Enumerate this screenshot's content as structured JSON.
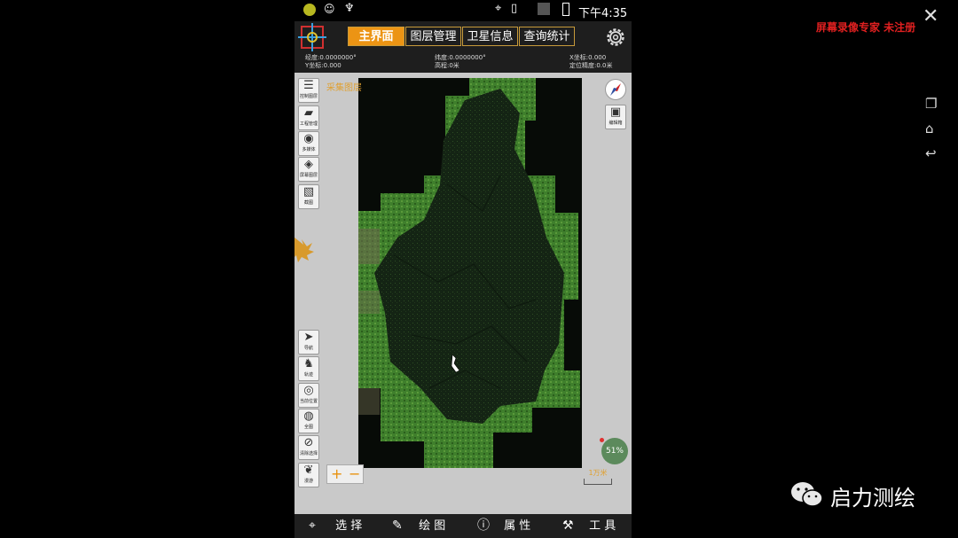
{
  "status_bar": {
    "time": "下午4:35"
  },
  "toolbar": {
    "tabs": [
      {
        "label": "主界面",
        "active": true
      },
      {
        "label": "图层管理",
        "active": false
      },
      {
        "label": "卫星信息",
        "active": false
      },
      {
        "label": "查询统计",
        "active": false
      }
    ]
  },
  "coords": {
    "lon": "经度:0.0000000°",
    "y": "Y坐标:0.000",
    "lat": "纬度:0.0000000°",
    "elev": "高程:0米",
    "x": "X坐标:0.000",
    "acc": "定位精度:0.0米"
  },
  "map": {
    "layer_label": "采集图层",
    "battery": "51%",
    "scale": "1万米"
  },
  "left_tools": [
    {
      "icon": "list-icon",
      "label": "控制图层"
    },
    {
      "icon": "folder-icon",
      "label": "工程管理"
    },
    {
      "icon": "camera-icon",
      "label": "多媒体"
    },
    {
      "icon": "layers-icon",
      "label": "屏幕图层"
    },
    {
      "icon": "image-icon",
      "label": "截图"
    }
  ],
  "left_tools_lower": [
    {
      "icon": "navigate-icon",
      "label": "导航"
    },
    {
      "icon": "track-icon",
      "label": "轨迹"
    },
    {
      "icon": "locate-icon",
      "label": "当前位置"
    },
    {
      "icon": "globe-icon",
      "label": "全图"
    },
    {
      "icon": "clear-icon",
      "label": "清除选择"
    },
    {
      "icon": "footprint-icon",
      "label": "漫游"
    }
  ],
  "right_tools": [
    {
      "icon": "compass-icon",
      "label": ""
    },
    {
      "icon": "toolbox-icon",
      "label": "编辑箱"
    }
  ],
  "zoom": {
    "plus": "+",
    "minus": "−"
  },
  "bottom_bar": [
    {
      "icon": "select-icon",
      "label": "选 择"
    },
    {
      "icon": "pencil-icon",
      "label": "绘 图"
    },
    {
      "icon": "info-icon",
      "label": "属 性"
    },
    {
      "icon": "wrench-icon",
      "label": "工 具"
    }
  ],
  "watermark": {
    "recorder": "屏幕录像专家  未注册",
    "brand": "启力测绘"
  },
  "colors": {
    "accent": "#ec9414",
    "map_green": "#3f7f2c",
    "toolbar": "#1e1e1e"
  }
}
